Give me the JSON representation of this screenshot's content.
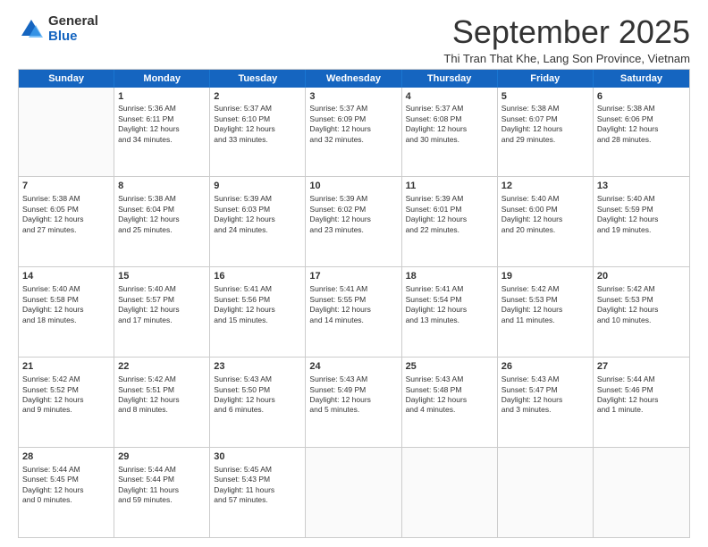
{
  "logo": {
    "general": "General",
    "blue": "Blue"
  },
  "title": "September 2025",
  "subtitle": "Thi Tran That Khe, Lang Son Province, Vietnam",
  "header": {
    "days": [
      "Sunday",
      "Monday",
      "Tuesday",
      "Wednesday",
      "Thursday",
      "Friday",
      "Saturday"
    ]
  },
  "rows": [
    [
      {
        "day": "",
        "lines": []
      },
      {
        "day": "1",
        "lines": [
          "Sunrise: 5:36 AM",
          "Sunset: 6:11 PM",
          "Daylight: 12 hours",
          "and 34 minutes."
        ]
      },
      {
        "day": "2",
        "lines": [
          "Sunrise: 5:37 AM",
          "Sunset: 6:10 PM",
          "Daylight: 12 hours",
          "and 33 minutes."
        ]
      },
      {
        "day": "3",
        "lines": [
          "Sunrise: 5:37 AM",
          "Sunset: 6:09 PM",
          "Daylight: 12 hours",
          "and 32 minutes."
        ]
      },
      {
        "day": "4",
        "lines": [
          "Sunrise: 5:37 AM",
          "Sunset: 6:08 PM",
          "Daylight: 12 hours",
          "and 30 minutes."
        ]
      },
      {
        "day": "5",
        "lines": [
          "Sunrise: 5:38 AM",
          "Sunset: 6:07 PM",
          "Daylight: 12 hours",
          "and 29 minutes."
        ]
      },
      {
        "day": "6",
        "lines": [
          "Sunrise: 5:38 AM",
          "Sunset: 6:06 PM",
          "Daylight: 12 hours",
          "and 28 minutes."
        ]
      }
    ],
    [
      {
        "day": "7",
        "lines": [
          "Sunrise: 5:38 AM",
          "Sunset: 6:05 PM",
          "Daylight: 12 hours",
          "and 27 minutes."
        ]
      },
      {
        "day": "8",
        "lines": [
          "Sunrise: 5:38 AM",
          "Sunset: 6:04 PM",
          "Daylight: 12 hours",
          "and 25 minutes."
        ]
      },
      {
        "day": "9",
        "lines": [
          "Sunrise: 5:39 AM",
          "Sunset: 6:03 PM",
          "Daylight: 12 hours",
          "and 24 minutes."
        ]
      },
      {
        "day": "10",
        "lines": [
          "Sunrise: 5:39 AM",
          "Sunset: 6:02 PM",
          "Daylight: 12 hours",
          "and 23 minutes."
        ]
      },
      {
        "day": "11",
        "lines": [
          "Sunrise: 5:39 AM",
          "Sunset: 6:01 PM",
          "Daylight: 12 hours",
          "and 22 minutes."
        ]
      },
      {
        "day": "12",
        "lines": [
          "Sunrise: 5:40 AM",
          "Sunset: 6:00 PM",
          "Daylight: 12 hours",
          "and 20 minutes."
        ]
      },
      {
        "day": "13",
        "lines": [
          "Sunrise: 5:40 AM",
          "Sunset: 5:59 PM",
          "Daylight: 12 hours",
          "and 19 minutes."
        ]
      }
    ],
    [
      {
        "day": "14",
        "lines": [
          "Sunrise: 5:40 AM",
          "Sunset: 5:58 PM",
          "Daylight: 12 hours",
          "and 18 minutes."
        ]
      },
      {
        "day": "15",
        "lines": [
          "Sunrise: 5:40 AM",
          "Sunset: 5:57 PM",
          "Daylight: 12 hours",
          "and 17 minutes."
        ]
      },
      {
        "day": "16",
        "lines": [
          "Sunrise: 5:41 AM",
          "Sunset: 5:56 PM",
          "Daylight: 12 hours",
          "and 15 minutes."
        ]
      },
      {
        "day": "17",
        "lines": [
          "Sunrise: 5:41 AM",
          "Sunset: 5:55 PM",
          "Daylight: 12 hours",
          "and 14 minutes."
        ]
      },
      {
        "day": "18",
        "lines": [
          "Sunrise: 5:41 AM",
          "Sunset: 5:54 PM",
          "Daylight: 12 hours",
          "and 13 minutes."
        ]
      },
      {
        "day": "19",
        "lines": [
          "Sunrise: 5:42 AM",
          "Sunset: 5:53 PM",
          "Daylight: 12 hours",
          "and 11 minutes."
        ]
      },
      {
        "day": "20",
        "lines": [
          "Sunrise: 5:42 AM",
          "Sunset: 5:53 PM",
          "Daylight: 12 hours",
          "and 10 minutes."
        ]
      }
    ],
    [
      {
        "day": "21",
        "lines": [
          "Sunrise: 5:42 AM",
          "Sunset: 5:52 PM",
          "Daylight: 12 hours",
          "and 9 minutes."
        ]
      },
      {
        "day": "22",
        "lines": [
          "Sunrise: 5:42 AM",
          "Sunset: 5:51 PM",
          "Daylight: 12 hours",
          "and 8 minutes."
        ]
      },
      {
        "day": "23",
        "lines": [
          "Sunrise: 5:43 AM",
          "Sunset: 5:50 PM",
          "Daylight: 12 hours",
          "and 6 minutes."
        ]
      },
      {
        "day": "24",
        "lines": [
          "Sunrise: 5:43 AM",
          "Sunset: 5:49 PM",
          "Daylight: 12 hours",
          "and 5 minutes."
        ]
      },
      {
        "day": "25",
        "lines": [
          "Sunrise: 5:43 AM",
          "Sunset: 5:48 PM",
          "Daylight: 12 hours",
          "and 4 minutes."
        ]
      },
      {
        "day": "26",
        "lines": [
          "Sunrise: 5:43 AM",
          "Sunset: 5:47 PM",
          "Daylight: 12 hours",
          "and 3 minutes."
        ]
      },
      {
        "day": "27",
        "lines": [
          "Sunrise: 5:44 AM",
          "Sunset: 5:46 PM",
          "Daylight: 12 hours",
          "and 1 minute."
        ]
      }
    ],
    [
      {
        "day": "28",
        "lines": [
          "Sunrise: 5:44 AM",
          "Sunset: 5:45 PM",
          "Daylight: 12 hours",
          "and 0 minutes."
        ]
      },
      {
        "day": "29",
        "lines": [
          "Sunrise: 5:44 AM",
          "Sunset: 5:44 PM",
          "Daylight: 11 hours",
          "and 59 minutes."
        ]
      },
      {
        "day": "30",
        "lines": [
          "Sunrise: 5:45 AM",
          "Sunset: 5:43 PM",
          "Daylight: 11 hours",
          "and 57 minutes."
        ]
      },
      {
        "day": "",
        "lines": []
      },
      {
        "day": "",
        "lines": []
      },
      {
        "day": "",
        "lines": []
      },
      {
        "day": "",
        "lines": []
      }
    ]
  ]
}
